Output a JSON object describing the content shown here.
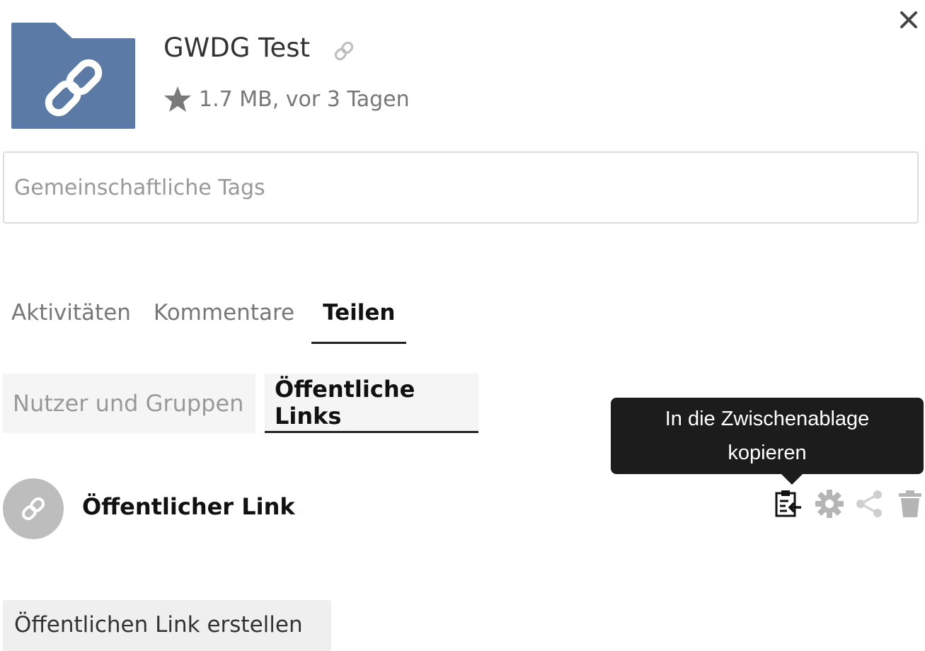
{
  "file": {
    "name": "GWDG Test",
    "meta": "1.7 MB, vor 3 Tagen"
  },
  "tags": {
    "placeholder": "Gemeinschaftliche Tags"
  },
  "tabs": [
    {
      "label": "Aktivitäten"
    },
    {
      "label": "Kommentare"
    },
    {
      "label": "Teilen"
    }
  ],
  "share_subtabs": [
    {
      "label": "Nutzer und Gruppen"
    },
    {
      "label": "Öffentliche Links"
    }
  ],
  "tooltip": {
    "line1": "In die Zwischenablage",
    "line2": "kopieren"
  },
  "public_link": {
    "title": "Öffentlicher Link"
  },
  "create_button": {
    "label": "Öffentlichen Link erstellen"
  },
  "colors": {
    "folder": "#5b7aa5",
    "avatar": "#bdbdbd",
    "tooltip_bg": "#1c1c1c"
  }
}
